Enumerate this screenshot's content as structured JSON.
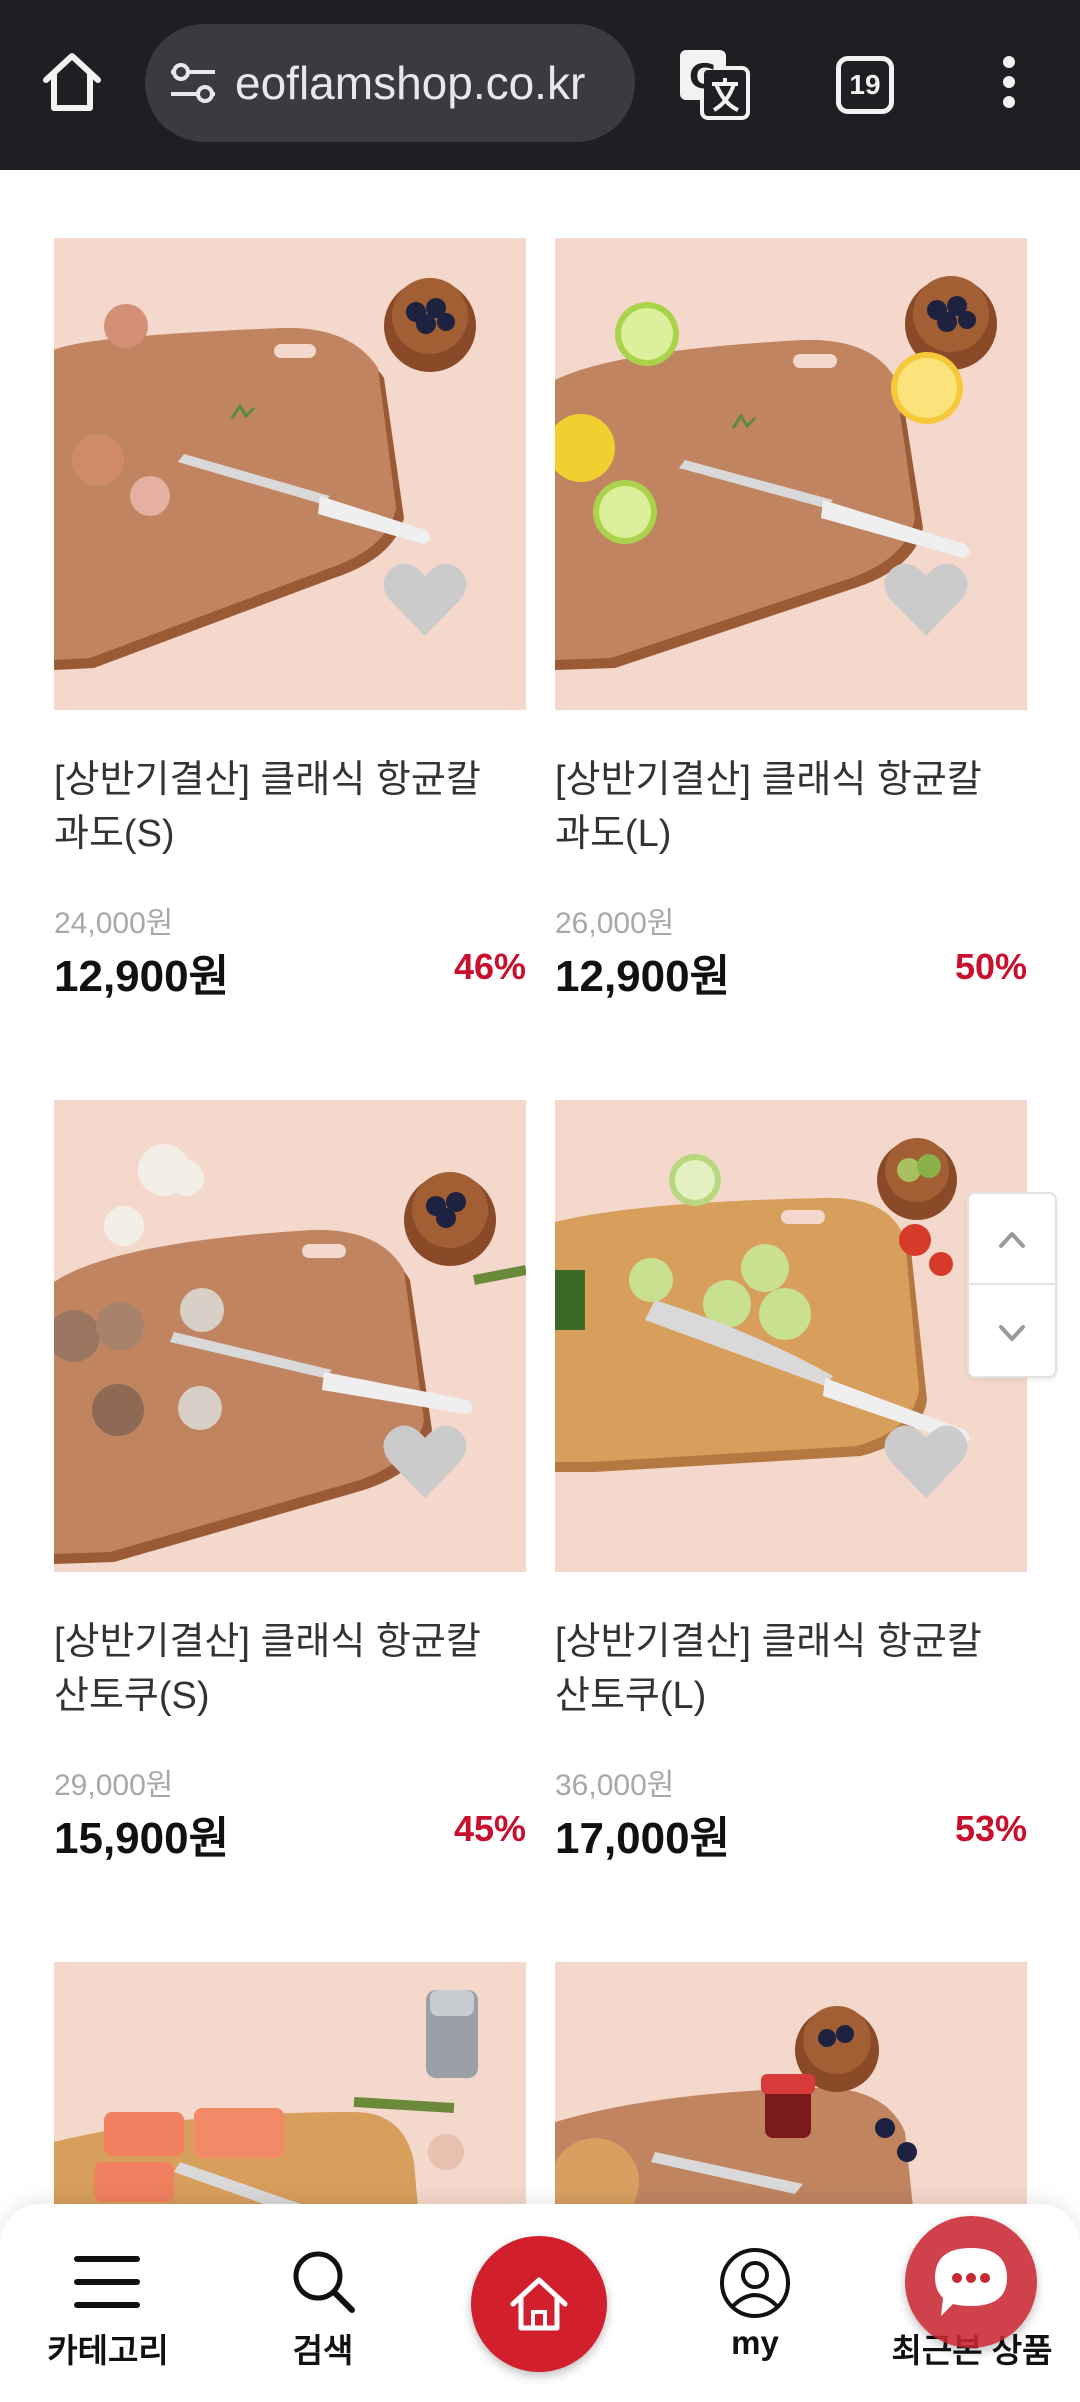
{
  "browser": {
    "url": "eoflamshop.co.kr",
    "tab_count": "19"
  },
  "products": [
    {
      "name_line1": "[상반기결산] 클래식 항균칼",
      "name_line2": "과도(S)",
      "original_price": "24,000원",
      "sale_price": "12,900원",
      "discount": "46%",
      "scene": "onion"
    },
    {
      "name_line1": "[상반기결산] 클래식 항균칼",
      "name_line2": "과도(L)",
      "original_price": "26,000원",
      "sale_price": "12,900원",
      "discount": "50%",
      "scene": "lemon"
    },
    {
      "name_line1": "[상반기결산] 클래식 항균칼",
      "name_line2": "산토쿠(S)",
      "original_price": "29,000원",
      "sale_price": "15,900원",
      "discount": "45%",
      "scene": "mushroom"
    },
    {
      "name_line1": "[상반기결산] 클래식 항균칼",
      "name_line2": "산토쿠(L)",
      "original_price": "36,000원",
      "sale_price": "17,000원",
      "discount": "53%",
      "scene": "zucchini"
    },
    {
      "scene": "salmon"
    },
    {
      "scene": "bagel"
    }
  ],
  "bottom_nav": {
    "category_label": "카테고리",
    "search_label": "검색",
    "my_label": "my",
    "recent_label": "최근본 상품"
  },
  "colors": {
    "accent_red": "#d11f2e",
    "discount_red": "#c8102e",
    "browser_bar": "#1e1f22"
  }
}
